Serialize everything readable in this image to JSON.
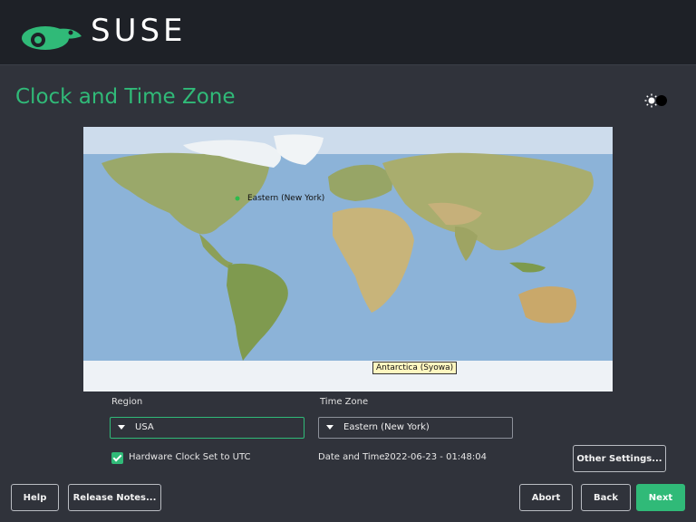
{
  "header": {
    "brand": "SUSE",
    "logo_icon": "suse-chameleon-icon"
  },
  "page": {
    "title": "Clock and Time Zone",
    "theme_icon": "theme-toggle-icon"
  },
  "map": {
    "selected_label": "Eastern (New York)",
    "tooltip": "Antarctica (Syowa)"
  },
  "region": {
    "label": "Region",
    "value": "USA"
  },
  "timezone": {
    "label": "Time Zone",
    "value": "Eastern (New York)"
  },
  "hardware_clock": {
    "label": "Hardware Clock Set to UTC",
    "checked": true
  },
  "datetime": {
    "label": "Date and Time:",
    "value": "2022-06-23 - 01:48:04"
  },
  "buttons": {
    "other_settings": "Other Settings...",
    "help": "Help",
    "release_notes": "Release Notes...",
    "abort": "Abort",
    "back": "Back",
    "next": "Next"
  },
  "colors": {
    "accent": "#30ba78",
    "background": "#30333b",
    "topbar": "#1e2127"
  }
}
